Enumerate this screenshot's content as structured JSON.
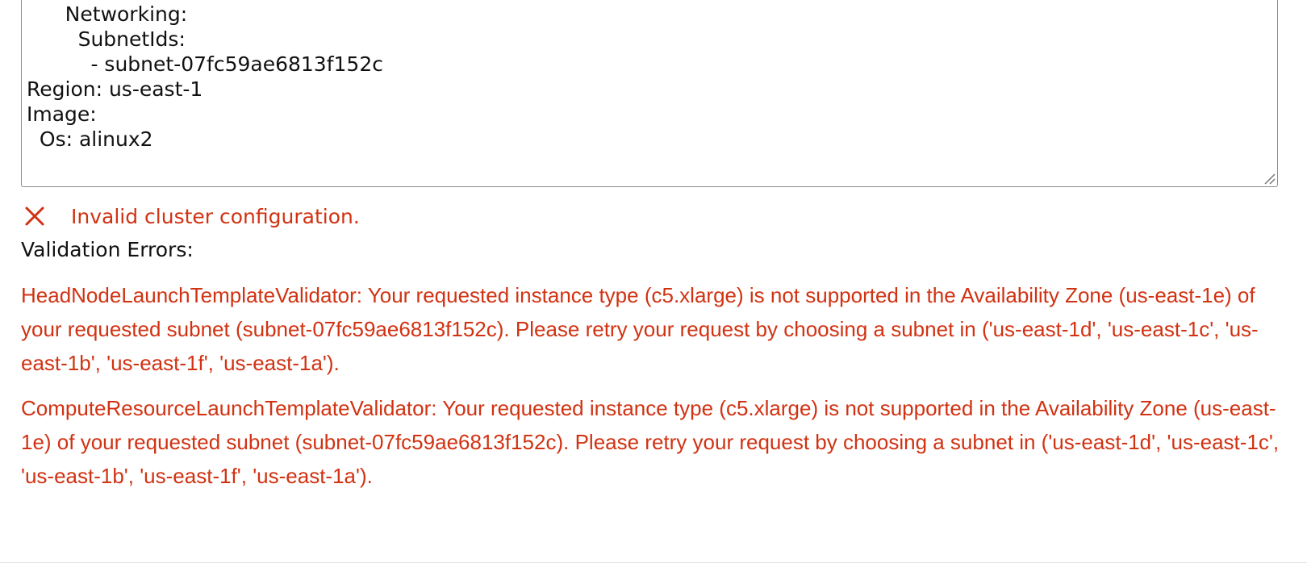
{
  "config_editor": {
    "lines": [
      "      Networking:",
      "        SubnetIds:",
      "          - subnet-07fc59ae6813f152c",
      "Region: us-east-1",
      "Image:",
      "  Os: alinux2"
    ]
  },
  "validation": {
    "status_icon": "error-x-icon",
    "status_text": "Invalid cluster configuration.",
    "errors_heading": "Validation Errors:",
    "errors": [
      "HeadNodeLaunchTemplateValidator: Your requested instance type (c5.xlarge) is not supported in the Availability Zone (us-east-1e) of your requested subnet (subnet-07fc59ae6813f152c). Please retry your request by choosing a subnet in ('us-east-1d', 'us-east-1c', 'us-east-1b', 'us-east-1f', 'us-east-1a').",
      "ComputeResourceLaunchTemplateValidator: Your requested instance type (c5.xlarge) is not supported in the Availability Zone (us-east-1e) of your requested subnet (subnet-07fc59ae6813f152c). Please retry your request by choosing a subnet in ('us-east-1d', 'us-east-1c', 'us-east-1b', 'us-east-1f', 'us-east-1a')."
    ]
  },
  "colors": {
    "error": "#d13212",
    "text": "#111111",
    "border": "#8c8c8c"
  }
}
